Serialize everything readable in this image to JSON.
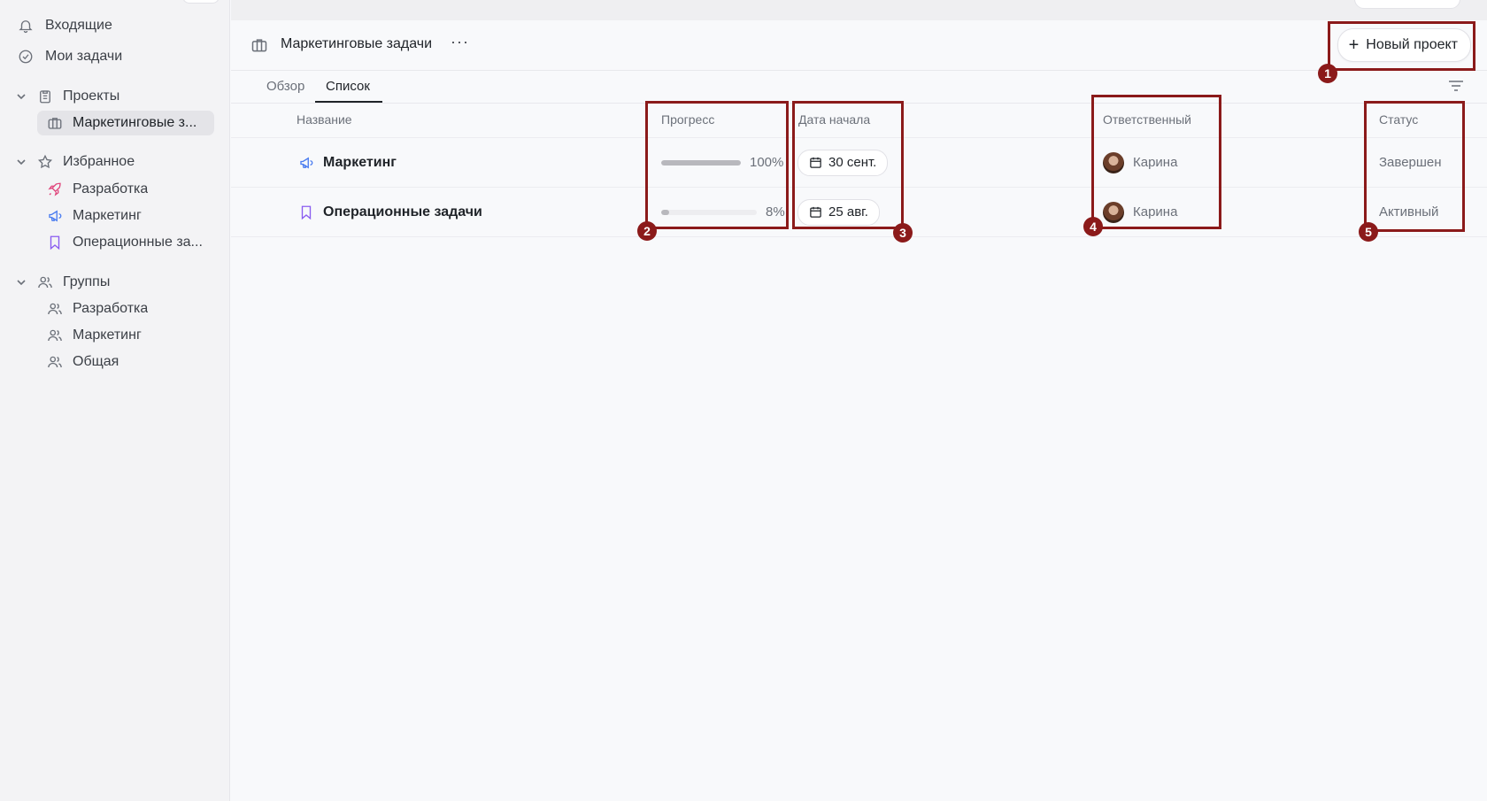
{
  "sidebar": {
    "inbox": "Входящие",
    "my_tasks": "Мои задачи",
    "projects": {
      "label": "Проекты",
      "items": [
        {
          "label": "Маркетинговые з...",
          "active": true
        }
      ]
    },
    "favorites": {
      "label": "Избранное",
      "items": [
        {
          "label": "Разработка",
          "icon": "rocket-icon",
          "color": "#e0467c"
        },
        {
          "label": "Маркетинг",
          "icon": "megaphone-icon",
          "color": "#4a7cf0"
        },
        {
          "label": "Операционные за...",
          "icon": "bookmark-icon",
          "color": "#8a5cf0"
        }
      ]
    },
    "groups": {
      "label": "Группы",
      "items": [
        {
          "label": "Разработка"
        },
        {
          "label": "Маркетинг"
        },
        {
          "label": "Общая"
        }
      ]
    }
  },
  "header": {
    "title": "Маркетинговые задачи",
    "more": "···",
    "new_project_label": "Новый проект"
  },
  "tabs": [
    {
      "label": "Обзор"
    },
    {
      "label": "Список",
      "active": true
    }
  ],
  "table": {
    "columns": {
      "name": "Название",
      "progress": "Прогресс",
      "start_date": "Дата начала",
      "owner": "Ответственный",
      "status": "Статус"
    },
    "rows": [
      {
        "name": "Маркетинг",
        "icon": "megaphone-icon",
        "progress_label": "100%",
        "progress": 1.0,
        "start_date": "30 сент.",
        "owner": "Карина",
        "status": "Завершен"
      },
      {
        "name": "Операционные задачи",
        "icon": "bookmark-icon",
        "progress_label": "8%",
        "progress": 0.08,
        "start_date": "25 авг.",
        "owner": "Карина",
        "status": "Активный"
      }
    ]
  },
  "annotations": [
    "1",
    "2",
    "3",
    "4",
    "5"
  ],
  "colors": {
    "annotation": "#8b1a1a",
    "accent_blue": "#4a7cf0",
    "accent_purple": "#8a5cf0",
    "accent_pink": "#e0467c"
  }
}
